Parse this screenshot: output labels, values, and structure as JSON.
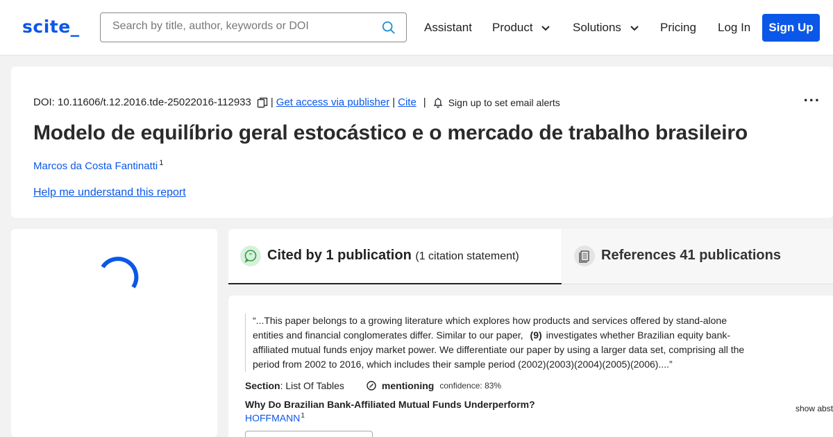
{
  "header": {
    "logo": "scite_",
    "search_placeholder": "Search by title, author, keywords or DOI",
    "nav": {
      "assistant": "Assistant",
      "product": "Product",
      "solutions": "Solutions",
      "pricing": "Pricing",
      "login": "Log In",
      "signup": "Sign Up"
    },
    "brand_color": "#0b57e8"
  },
  "paper": {
    "doi": "DOI: 10.11606/t.12.2016.tde-25022016-112933",
    "get_access": "Get access via publisher",
    "cite": "Cite",
    "separator": "|",
    "alert": "Sign up to set email alerts",
    "more": "...",
    "title": "Modelo de equilíbrio geral estocástico e o mercado de trabalho brasileiro",
    "author": "Marcos da Costa Fantinatti",
    "author_sup": "1",
    "help": "Help me understand this report"
  },
  "tabs": {
    "cited": {
      "label": "Cited by 1 publication",
      "sub": "(1 citation statement)"
    },
    "references": {
      "label": "References 41 publications"
    }
  },
  "citation": {
    "quote_before": "“...This paper belongs to a growing literature which explores how products and services offered by stand-alone entities and financial conglomerates differ. Similar to our paper,",
    "ref": "(9)",
    "quote_after": "investigates whether Brazilian equity bank-affiliated mutual funds enjoy market power. We differentiate our paper by using a larger data set, comprising all the period from 2002 to 2016, which includes their sample period (2002)(2003)(2004)(2005)(2006)....”",
    "section_label": "Section",
    "section_value": ": List Of Tables",
    "classification": "mentioning",
    "confidence": "confidence: 83%",
    "cited_title": "Why Do Brazilian Bank-Affiliated Mutual Funds Underperform?",
    "cited_author": "HOFFMANN",
    "cited_author_sup": "1",
    "show_abstract": "show abst"
  }
}
